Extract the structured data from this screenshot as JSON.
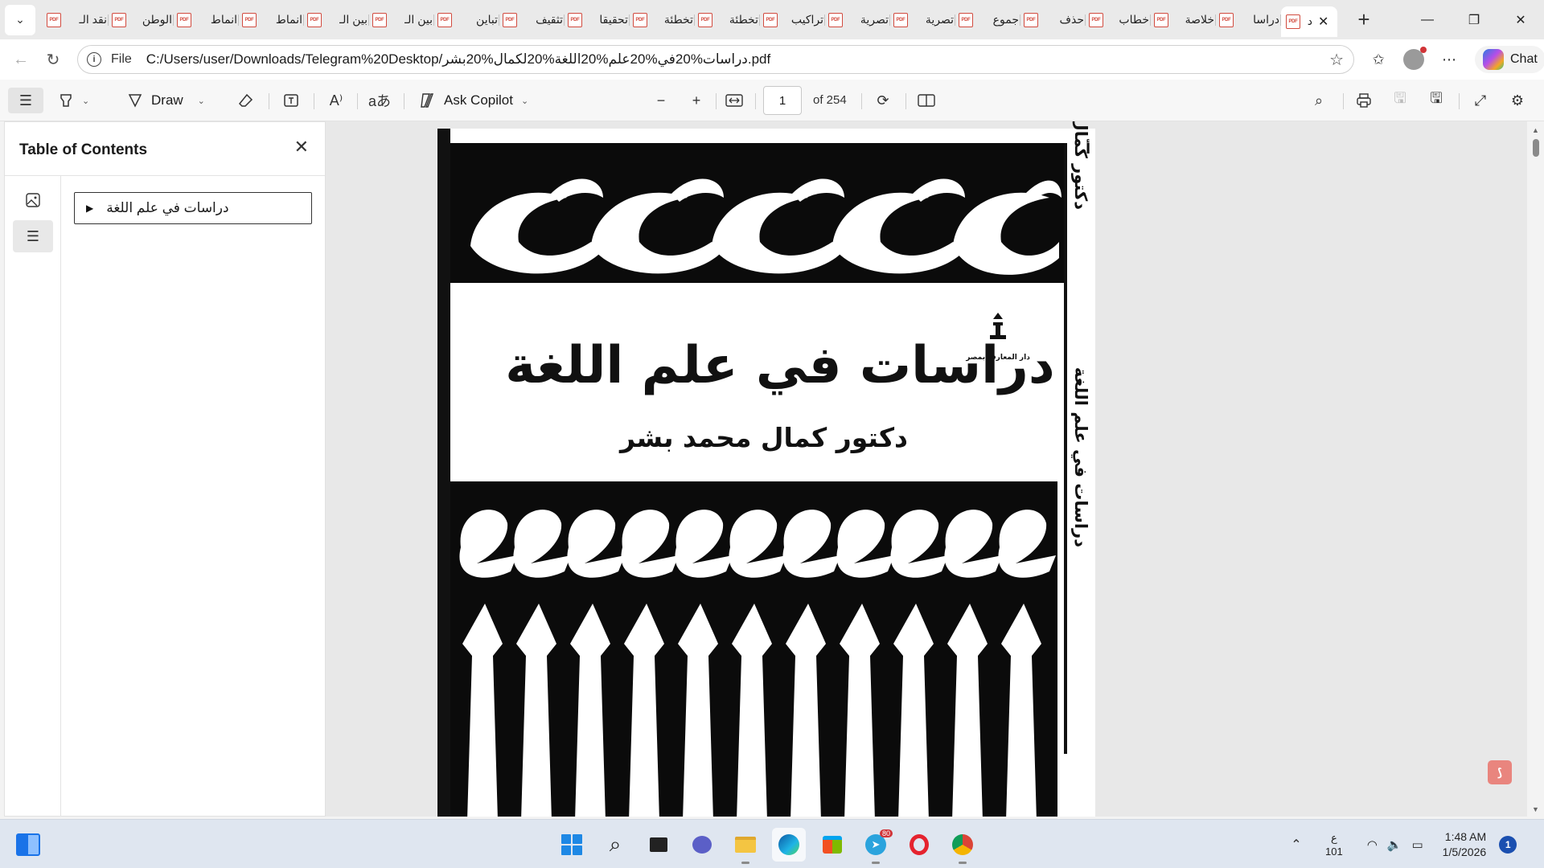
{
  "window": {
    "tab_menu_icon": "chevron-down-icon",
    "tabs": [
      {
        "title": "نقد الـ"
      },
      {
        "title": "الوطن"
      },
      {
        "title": "انماط"
      },
      {
        "title": "انماط"
      },
      {
        "title": "بين الـ"
      },
      {
        "title": "بين الـ"
      },
      {
        "title": "تباين"
      },
      {
        "title": "تثقيف"
      },
      {
        "title": "تحقيقا"
      },
      {
        "title": "تخطئة"
      },
      {
        "title": "تخطئة"
      },
      {
        "title": "تراكيب"
      },
      {
        "title": "تصرية"
      },
      {
        "title": "تصرية"
      },
      {
        "title": "جموع"
      },
      {
        "title": "حذف"
      },
      {
        "title": "خطاب"
      },
      {
        "title": "خلاصة"
      },
      {
        "title": "دراسا"
      }
    ],
    "active_tab": {
      "title": "د"
    },
    "new_tab_label": "+",
    "controls": {
      "minimize": "—",
      "restore": "❐",
      "close": "✕"
    }
  },
  "address_bar": {
    "file_label": "File",
    "url": "C:/Users/user/Downloads/Telegram%20Desktop/دراسات%20في%20علم%20اللغة%20لكمال%20بشر.pdf",
    "chat_label": "Chat"
  },
  "pdf_toolbar": {
    "draw_label": "Draw",
    "ask_copilot_label": "Ask Copilot",
    "current_page": "1",
    "page_count_label": "of 254",
    "highlight_icon": "highlighter-icon",
    "draw_icon": "pen-icon",
    "eraser_icon": "eraser-icon",
    "text_icon": "text-box-icon",
    "read_aloud_icon": "read-aloud-icon",
    "translate_icon": "translate-icon",
    "zoom_out": "−",
    "zoom_in": "+"
  },
  "side_panel": {
    "title": "Table of Contents",
    "toc_items": [
      {
        "label": "دراسات في علم اللغة"
      }
    ]
  },
  "document": {
    "title": "دراسات في علم اللغة",
    "author": "دكتور كمال محمد بشر",
    "publisher": "دار المعارف بمصر",
    "spine_author": "دكتور كمال محمد بشر",
    "spine_title": "دراسات في علم اللغة",
    "spine_mark": "أ"
  },
  "taskbar": {
    "apps": [
      {
        "name": "start",
        "badge": ""
      },
      {
        "name": "search",
        "badge": ""
      },
      {
        "name": "task-view",
        "badge": ""
      },
      {
        "name": "teams-chat",
        "badge": ""
      },
      {
        "name": "file-explorer",
        "badge": ""
      },
      {
        "name": "edge",
        "badge": ""
      },
      {
        "name": "store",
        "badge": ""
      },
      {
        "name": "telegram",
        "badge": "80"
      },
      {
        "name": "opera",
        "badge": ""
      },
      {
        "name": "chrome",
        "badge": ""
      }
    ],
    "language_top": "ع",
    "language_bottom": "101",
    "time": "1:48 AM",
    "date": "1/5/2026",
    "notification_count": "1"
  }
}
